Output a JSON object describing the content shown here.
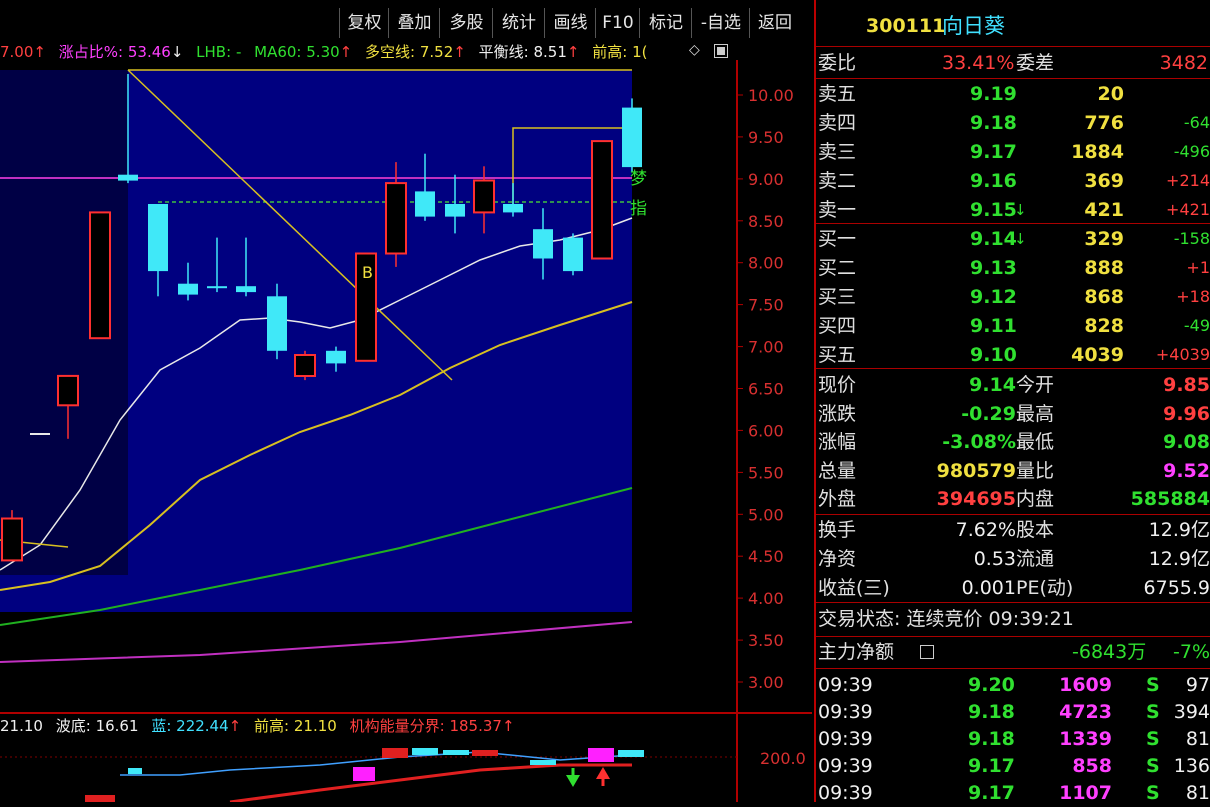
{
  "toolbar": {
    "buttons": [
      "复权",
      "叠加",
      "多股",
      "统计",
      "画线",
      "F10",
      "标记",
      "-自选",
      "返回"
    ]
  },
  "indicators": {
    "first_value": "7.00",
    "zhan_label": "涨占比%:",
    "zhan_value": "53.46",
    "lhb_label": "LHB:",
    "lhb_value": "-",
    "ma60_label": "MA60:",
    "ma60_value": "5.30",
    "duokong_label": "多空线:",
    "duokong_value": "7.52",
    "pingheng_label": "平衡线:",
    "pingheng_value": "8.51",
    "qiangao_label": "前高:",
    "qiangao_value": "1("
  },
  "volume_indicators": {
    "first_value": "21.10",
    "bodi_label": "波底:",
    "bodi_value": "16.61",
    "lan_label": "蓝:",
    "lan_value": "222.44",
    "qiangao_label": "前高:",
    "qiangao_value": "21.10",
    "jigou_label": "机构能量分界:",
    "jigou_value": "185.37"
  },
  "chart_data": {
    "type": "candlestick",
    "y_axis_labels": [
      "10.00",
      "9.50",
      "9.00",
      "8.50",
      "8.00",
      "7.50",
      "7.00",
      "6.50",
      "6.00",
      "5.50",
      "5.00",
      "4.50",
      "4.00",
      "3.50",
      "3.00"
    ],
    "y_range": [
      2.9,
      10.4
    ],
    "volume_axis_label": "200.0",
    "markers": [
      "B",
      "梦",
      "指"
    ],
    "candles": [
      {
        "o": 4.45,
        "c": 4.95,
        "h": 5.05,
        "l": 4.45
      },
      {
        "o": 6.3,
        "c": 6.65,
        "h": 6.65,
        "l": 5.9
      },
      {
        "o": 7.1,
        "c": 8.6,
        "h": 8.6,
        "l": 7.1
      },
      {
        "o": 9.05,
        "c": 8.98,
        "h": 10.25,
        "l": 8.95
      },
      {
        "o": 8.7,
        "c": 7.9,
        "h": 8.7,
        "l": 7.6
      },
      {
        "o": 7.75,
        "c": 7.62,
        "h": 8.0,
        "l": 7.55
      },
      {
        "o": 7.72,
        "c": 7.7,
        "h": 8.3,
        "l": 7.65
      },
      {
        "o": 7.72,
        "c": 7.65,
        "h": 8.3,
        "l": 7.6
      },
      {
        "o": 7.6,
        "c": 6.95,
        "h": 7.75,
        "l": 6.85
      },
      {
        "o": 6.65,
        "c": 6.9,
        "h": 6.95,
        "l": 6.6
      },
      {
        "o": 6.95,
        "c": 6.8,
        "h": 7.0,
        "l": 6.7
      },
      {
        "o": 6.83,
        "c": 8.11,
        "h": 8.11,
        "l": 6.83
      },
      {
        "o": 8.11,
        "c": 8.95,
        "h": 9.2,
        "l": 7.95
      },
      {
        "o": 8.85,
        "c": 8.55,
        "h": 9.3,
        "l": 8.5
      },
      {
        "o": 8.7,
        "c": 8.55,
        "h": 9.05,
        "l": 8.35
      },
      {
        "o": 8.6,
        "c": 8.98,
        "h": 9.15,
        "l": 8.35
      },
      {
        "o": 8.7,
        "c": 8.6,
        "h": 8.95,
        "l": 8.55
      },
      {
        "o": 8.4,
        "c": 8.05,
        "h": 8.65,
        "l": 7.8
      },
      {
        "o": 8.3,
        "c": 7.9,
        "h": 8.35,
        "l": 7.85
      },
      {
        "o": 8.05,
        "c": 9.45,
        "h": 9.45,
        "l": 8.05
      },
      {
        "o": 9.85,
        "c": 9.14,
        "h": 9.96,
        "l": 9.08
      }
    ]
  },
  "stock": {
    "code": "300111",
    "name": "向日葵"
  },
  "weibi": {
    "label": "委比",
    "value": "33.41%",
    "diff_label": "委差",
    "diff_value": "3482"
  },
  "sell_orders": [
    {
      "label": "卖五",
      "price": "9.19",
      "volume": "20",
      "change": ""
    },
    {
      "label": "卖四",
      "price": "9.18",
      "volume": "776",
      "change": "-64"
    },
    {
      "label": "卖三",
      "price": "9.17",
      "volume": "1884",
      "change": "-496"
    },
    {
      "label": "卖二",
      "price": "9.16",
      "volume": "369",
      "change": "+214"
    },
    {
      "label": "卖一",
      "price": "9.15",
      "volume": "421",
      "change": "+421"
    }
  ],
  "buy_orders": [
    {
      "label": "买一",
      "price": "9.14",
      "volume": "329",
      "change": "-158"
    },
    {
      "label": "买二",
      "price": "9.13",
      "volume": "888",
      "change": "+1"
    },
    {
      "label": "买三",
      "price": "9.12",
      "volume": "868",
      "change": "+18"
    },
    {
      "label": "买四",
      "price": "9.11",
      "volume": "828",
      "change": "-49"
    },
    {
      "label": "买五",
      "price": "9.10",
      "volume": "4039",
      "change": "+4039"
    }
  ],
  "quote_stats": [
    {
      "l1": "现价",
      "v1": "9.14",
      "c1": "green",
      "l2": "今开",
      "v2": "9.85",
      "c2": "red"
    },
    {
      "l1": "涨跌",
      "v1": "-0.29",
      "c1": "green",
      "l2": "最高",
      "v2": "9.96",
      "c2": "red"
    },
    {
      "l1": "涨幅",
      "v1": "-3.08%",
      "c1": "green",
      "l2": "最低",
      "v2": "9.08",
      "c2": "green"
    },
    {
      "l1": "总量",
      "v1": "980579",
      "c1": "yellow",
      "l2": "量比",
      "v2": "9.52",
      "c2": "magenta"
    },
    {
      "l1": "外盘",
      "v1": "394695",
      "c1": "red",
      "l2": "内盘",
      "v2": "585884",
      "c2": "green"
    }
  ],
  "fundamentals": [
    {
      "l1": "换手",
      "v1": "7.62%",
      "l2": "股本",
      "v2": "12.9亿"
    },
    {
      "l1": "净资",
      "v1": "0.53",
      "l2": "流通",
      "v2": "12.9亿"
    },
    {
      "l1": "收益(三)",
      "v1": "0.001",
      "l2": "PE(动)",
      "v2": "6755.9"
    }
  ],
  "trade_status": {
    "label": "交易状态:",
    "value": "连续竞价",
    "time": "09:39:21"
  },
  "net_flow": {
    "label": "主力净额",
    "value": "-6843万",
    "pct": "-7%"
  },
  "ticks": [
    {
      "time": "09:39",
      "price": "9.20",
      "volume": "1609",
      "side": "S",
      "count": "97"
    },
    {
      "time": "09:39",
      "price": "9.18",
      "volume": "4723",
      "side": "S",
      "count": "394"
    },
    {
      "time": "09:39",
      "price": "9.18",
      "volume": "1339",
      "side": "S",
      "count": "81"
    },
    {
      "time": "09:39",
      "price": "9.17",
      "volume": "858",
      "side": "S",
      "count": "136"
    },
    {
      "time": "09:39",
      "price": "9.17",
      "volume": "1107",
      "side": "S",
      "count": "81"
    }
  ],
  "colors": {
    "up": "#ff3030",
    "down": "#40e8f8",
    "bg_panel": "#000080",
    "axis": "#b00000"
  }
}
